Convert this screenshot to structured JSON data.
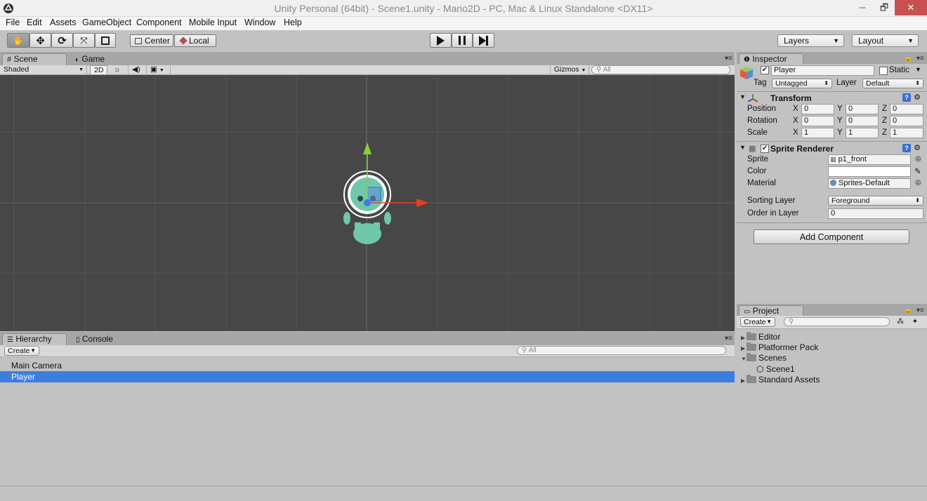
{
  "window": {
    "title": "Unity Personal (64bit) - Scene1.unity - Mario2D - PC, Mac & Linux Standalone <DX11>",
    "minimize": "─",
    "maximize": "🗗",
    "close": "✕"
  },
  "menu": [
    "File",
    "Edit",
    "Assets",
    "GameObject",
    "Component",
    "Mobile Input",
    "Window",
    "Help"
  ],
  "toolbar": {
    "pivot_label": "Center",
    "space_label": "Local",
    "layers_label": "Layers",
    "layout_label": "Layout"
  },
  "scene_panel": {
    "tabs": [
      "Scene",
      "Game"
    ],
    "shading": "Shaded",
    "mode_2d": "2D",
    "gizmos": "Gizmos",
    "search_placeholder": "All"
  },
  "hierarchy": {
    "tabs": [
      "Hierarchy",
      "Console"
    ],
    "create_label": "Create",
    "search_placeholder": "All",
    "items": [
      {
        "name": "Main Camera",
        "selected": false
      },
      {
        "name": "Player",
        "selected": true
      }
    ]
  },
  "inspector": {
    "tab": "Inspector",
    "object_name": "Player",
    "static_label": "Static",
    "tag_label": "Tag",
    "tag_value": "Untagged",
    "layer_label": "Layer",
    "layer_value": "Default",
    "transform": {
      "title": "Transform",
      "rows": [
        {
          "label": "Position",
          "x": "0",
          "y": "0",
          "z": "0"
        },
        {
          "label": "Rotation",
          "x": "0",
          "y": "0",
          "z": "0"
        },
        {
          "label": "Scale",
          "x": "1",
          "y": "1",
          "z": "1"
        }
      ]
    },
    "sprite_renderer": {
      "title": "Sprite Renderer",
      "sprite_label": "Sprite",
      "sprite_value": "p1_front",
      "color_label": "Color",
      "color_value": "#ffffff",
      "material_label": "Material",
      "material_value": "Sprites-Default",
      "sorting_layer_label": "Sorting Layer",
      "sorting_layer_value": "Foreground",
      "order_label": "Order in Layer",
      "order_value": "0"
    },
    "add_component": "Add Component"
  },
  "project": {
    "tab": "Project",
    "create_label": "Create",
    "items": [
      {
        "name": "Editor",
        "type": "folder",
        "expanded": false
      },
      {
        "name": "Platformer Pack",
        "type": "folder",
        "expanded": false
      },
      {
        "name": "Scenes",
        "type": "folder",
        "expanded": true
      },
      {
        "name": "Scene1",
        "type": "scene",
        "expanded": false
      },
      {
        "name": "Standard Assets",
        "type": "folder",
        "expanded": false
      }
    ]
  },
  "colors": {
    "selection": "#3d7ddd",
    "scene_bg": "#474747",
    "axis_x": "#e8401c",
    "axis_y": "#8ccf33",
    "character": "#6fc8aa"
  }
}
